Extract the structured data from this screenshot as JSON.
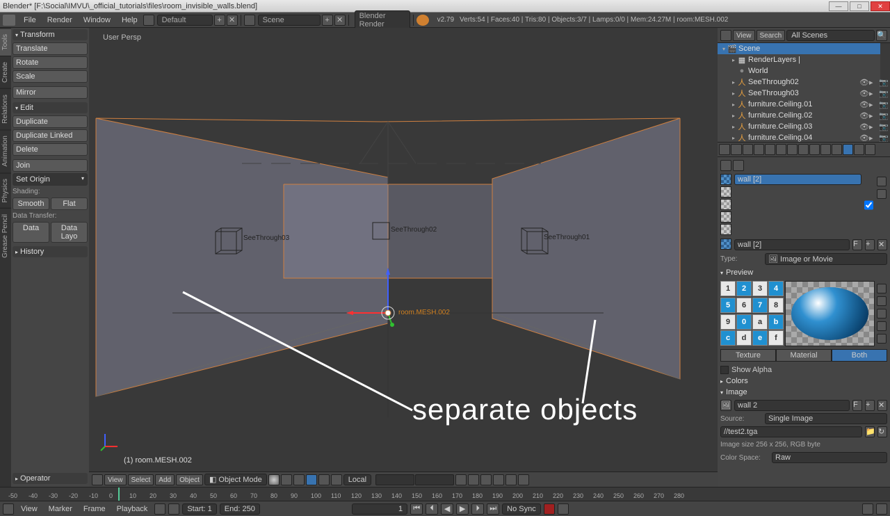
{
  "titlebar": "Blender* [F:\\Social\\IMVU\\_official_tutorials\\files\\room_invisible_walls.blend]",
  "window_buttons": {
    "min": "—",
    "max": "□",
    "close": "✕"
  },
  "menubar": {
    "file": "File",
    "render": "Render",
    "window": "Window",
    "help": "Help",
    "layout": "Default",
    "scene": "Scene",
    "renderer": "Blender Render",
    "version": "v2.79",
    "stats": "Verts:54 | Faces:40 | Tris:80 | Objects:3/7 | Lamps:0/0 | Mem:24.27M | room:MESH.002"
  },
  "left_tabs": [
    "Tools",
    "Create",
    "Relations",
    "Animation",
    "Physics",
    "Grease Pencil"
  ],
  "tool_panel": {
    "transform_h": "Transform",
    "translate": "Translate",
    "rotate": "Rotate",
    "scale": "Scale",
    "mirror": "Mirror",
    "edit_h": "Edit",
    "dup": "Duplicate",
    "dup_link": "Duplicate Linked",
    "delete": "Delete",
    "join": "Join",
    "set_origin": "Set Origin",
    "shading_l": "Shading:",
    "smooth": "Smooth",
    "flat": "Flat",
    "datatr_l": "Data Transfer:",
    "data": "Data",
    "data_layo": "Data Layo",
    "history_h": "History",
    "operator_h": "Operator"
  },
  "viewport": {
    "persp": "User Persp",
    "obj_see1": "SeeThrough01",
    "obj_see2": "SeeThrough02",
    "obj_see3": "SeeThrough03",
    "active_obj": "room.MESH.002",
    "info_line": "(1) room.MESH.002",
    "annotation": "separate objects"
  },
  "vp_header": {
    "view": "View",
    "select": "Select",
    "add": "Add",
    "object": "Object",
    "mode": "Object Mode",
    "orient": "Local"
  },
  "outliner_header": {
    "view": "View",
    "search": "Search",
    "filter": "All Scenes"
  },
  "outliner": [
    {
      "indent": 0,
      "icon": "scene",
      "name": "Scene",
      "sel": true,
      "tri": "▾"
    },
    {
      "indent": 1,
      "icon": "rl",
      "name": "RenderLayers  |",
      "tri": "▸"
    },
    {
      "indent": 1,
      "icon": "world",
      "name": "World",
      "tri": ""
    },
    {
      "indent": 1,
      "icon": "obj",
      "name": "SeeThrough02",
      "tri": "▸",
      "icons": true
    },
    {
      "indent": 1,
      "icon": "obj",
      "name": "SeeThrough03",
      "tri": "▸",
      "icons": true
    },
    {
      "indent": 1,
      "icon": "obj",
      "name": "furniture.Ceiling.01",
      "tri": "▸",
      "icons": true
    },
    {
      "indent": 1,
      "icon": "obj",
      "name": "furniture.Ceiling.02",
      "tri": "▸",
      "icons": true
    },
    {
      "indent": 1,
      "icon": "obj",
      "name": "furniture.Ceiling.03",
      "tri": "▸",
      "icons": true
    },
    {
      "indent": 1,
      "icon": "obj",
      "name": "furniture.Ceiling.04",
      "tri": "▸",
      "icons": true
    }
  ],
  "props": {
    "tex_name": "wall [2]",
    "tex_id": "wall [2]",
    "type_l": "Type:",
    "type_v": "Image or Movie",
    "preview_h": "Preview",
    "cells": [
      "1",
      "2",
      "3",
      "4",
      "5",
      "6",
      "7",
      "8",
      "9",
      "0",
      "a",
      "b",
      "c",
      "d",
      "e",
      "f"
    ],
    "tab_tex": "Texture",
    "tab_mat": "Material",
    "tab_both": "Both",
    "show_alpha": "Show Alpha",
    "colors_h": "Colors",
    "image_h": "Image",
    "img_name": "wall 2",
    "source_l": "Source:",
    "source_v": "Single Image",
    "path": "//test2.tga",
    "img_info": "Image size 256 x 256, RGB byte",
    "cspace_l": "Color Space:",
    "cspace_v": "Raw"
  },
  "timeline": {
    "ticks": [
      "-50",
      "-40",
      "-30",
      "-20",
      "-10",
      "0",
      "10",
      "20",
      "30",
      "40",
      "50",
      "60",
      "70",
      "80",
      "90",
      "100",
      "110",
      "120",
      "130",
      "140",
      "150",
      "160",
      "170",
      "180",
      "190",
      "200",
      "210",
      "220",
      "230",
      "240",
      "250",
      "260",
      "270",
      "280"
    ],
    "view": "View",
    "marker": "Marker",
    "frame": "Frame",
    "playback": "Playback",
    "start_l": "Start:",
    "start_v": "1",
    "end_l": "End:",
    "end_v": "250",
    "cur": "1",
    "sync": "No Sync"
  }
}
